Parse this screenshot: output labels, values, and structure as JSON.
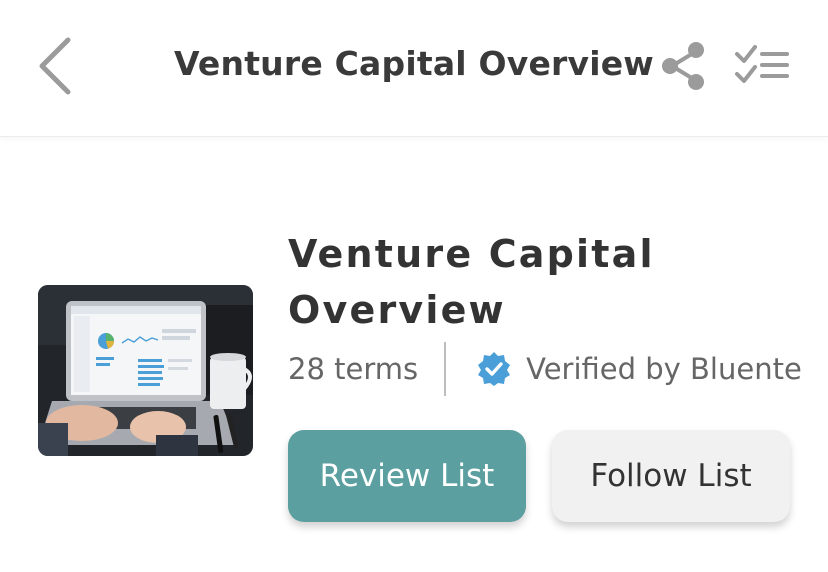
{
  "header": {
    "title": "Venture Capital Overview",
    "back_icon": "chevron-left-icon",
    "share_icon": "share-icon",
    "checklist_icon": "checklist-icon"
  },
  "list": {
    "title_line1": "Venture Capital",
    "title_line2": "Overview",
    "terms": "28 terms",
    "verified_text": "Verified by Bluente",
    "verified_icon": "verified-badge-icon",
    "thumbnail": "laptop-dashboard-photo"
  },
  "actions": {
    "review_label": "Review List",
    "follow_label": "Follow List"
  },
  "colors": {
    "accent": "#5b9fa0",
    "verified": "#4a9fd8",
    "icon_gray": "#9b9b9b"
  }
}
